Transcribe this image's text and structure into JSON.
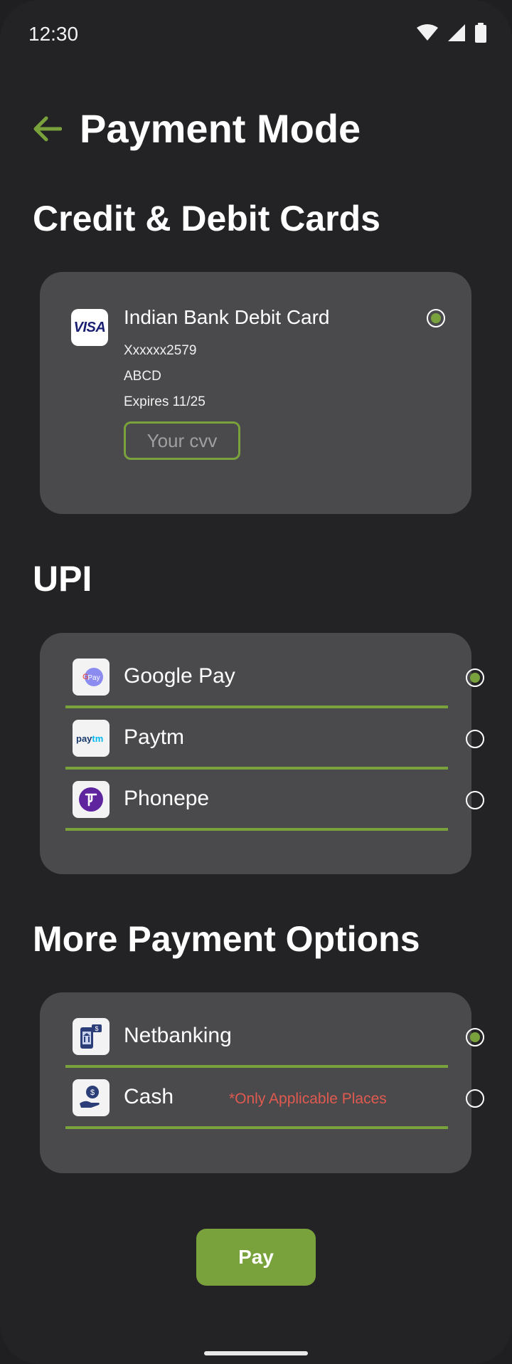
{
  "status_bar": {
    "time": "12:30"
  },
  "header": {
    "title": "Payment Mode"
  },
  "sections": {
    "cards_title": "Credit & Debit Cards",
    "upi_title": "UPI",
    "more_title": "More Payment Options"
  },
  "saved_card": {
    "brand": "VISA",
    "name": "Indian Bank Debit Card",
    "number": "Xxxxxx2579",
    "holder": "ABCD",
    "expiry": "Expires 11/25",
    "cvv_placeholder": "Your cvv",
    "selected": true
  },
  "upi": {
    "items": [
      {
        "label": "Google Pay",
        "icon": "google-pay-logo",
        "selected": true
      },
      {
        "label": "Paytm",
        "icon": "paytm-logo",
        "selected": false
      },
      {
        "label": "Phonepe",
        "icon": "phonepe-logo",
        "selected": false
      }
    ]
  },
  "more": {
    "items": [
      {
        "label": "Netbanking",
        "icon": "netbanking-icon",
        "selected": true
      },
      {
        "label": "Cash",
        "icon": "cash-icon",
        "note": "*Only Applicable Places",
        "selected": false
      }
    ]
  },
  "pay_button": {
    "label": "Pay"
  },
  "colors": {
    "accent": "#79a23c",
    "background": "#232325",
    "card": "#4a4a4c",
    "warning_text": "#e05a4f"
  }
}
